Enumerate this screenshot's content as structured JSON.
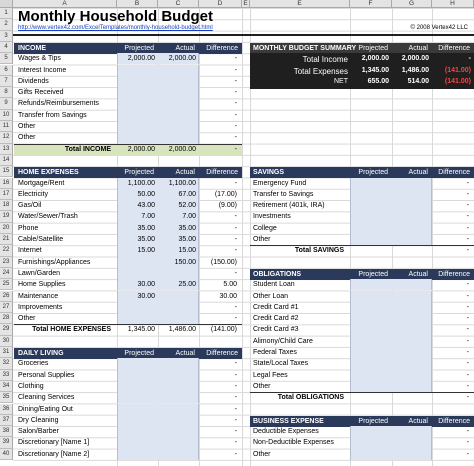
{
  "columns": [
    "A",
    "B",
    "C",
    "D",
    "E",
    "F",
    "G",
    "H"
  ],
  "rows": [
    "1",
    "2",
    "3",
    "4",
    "5",
    "6",
    "7",
    "8",
    "9",
    "10",
    "11",
    "12",
    "13",
    "14",
    "15",
    "16",
    "17",
    "18",
    "19",
    "20",
    "21",
    "22",
    "23",
    "24",
    "25",
    "26",
    "27",
    "28",
    "29",
    "30",
    "31",
    "32",
    "33",
    "34",
    "35",
    "36",
    "37",
    "38",
    "39",
    "40"
  ],
  "title": "Monthly Household Budget",
  "link": "http://www.vertex42.com/ExcelTemplates/monthly-household-budget.html",
  "copyright": "© 2008 Vertex42 LLC",
  "col_heads": {
    "projected": "Projected",
    "actual": "Actual",
    "difference": "Difference"
  },
  "income": {
    "header": "INCOME",
    "items": [
      {
        "label": "Wages & Tips",
        "projected": "2,000.00",
        "actual": "2,000.00",
        "diff": "-"
      },
      {
        "label": "Interest Income",
        "projected": "",
        "actual": "",
        "diff": "-"
      },
      {
        "label": "Dividends",
        "projected": "",
        "actual": "",
        "diff": "-"
      },
      {
        "label": "Gifts Received",
        "projected": "",
        "actual": "",
        "diff": "-"
      },
      {
        "label": "Refunds/Reimbursements",
        "projected": "",
        "actual": "",
        "diff": "-"
      },
      {
        "label": "Transfer from Savings",
        "projected": "",
        "actual": "",
        "diff": "-"
      },
      {
        "label": "Other",
        "projected": "",
        "actual": "",
        "diff": "-"
      },
      {
        "label": "Other",
        "projected": "",
        "actual": "",
        "diff": "-"
      }
    ],
    "total_label": "Total INCOME",
    "total_projected": "2,000.00",
    "total_actual": "2,000.00",
    "total_diff": "-"
  },
  "summary": {
    "header": "MONTHLY BUDGET SUMMARY",
    "rows": [
      {
        "label": "Total Income",
        "projected": "2,000.00",
        "actual": "2,000.00",
        "diff": "-"
      },
      {
        "label": "Total Expenses",
        "projected": "1,345.00",
        "actual": "1,486.00",
        "diff": "(141.00)"
      },
      {
        "label": "NET",
        "projected": "655.00",
        "actual": "514.00",
        "diff": "(141.00)"
      }
    ]
  },
  "home": {
    "header": "HOME EXPENSES",
    "items": [
      {
        "label": "Mortgage/Rent",
        "projected": "1,100.00",
        "actual": "1,100.00",
        "diff": "-"
      },
      {
        "label": "Electricity",
        "projected": "50.00",
        "actual": "67.00",
        "diff": "(17.00)"
      },
      {
        "label": "Gas/Oil",
        "projected": "43.00",
        "actual": "52.00",
        "diff": "(9.00)"
      },
      {
        "label": "Water/Sewer/Trash",
        "projected": "7.00",
        "actual": "7.00",
        "diff": "-"
      },
      {
        "label": "Phone",
        "projected": "35.00",
        "actual": "35.00",
        "diff": "-"
      },
      {
        "label": "Cable/Satellite",
        "projected": "35.00",
        "actual": "35.00",
        "diff": "-"
      },
      {
        "label": "Internet",
        "projected": "15.00",
        "actual": "15.00",
        "diff": "-"
      },
      {
        "label": "Furnishings/Appliances",
        "projected": "",
        "actual": "150.00",
        "diff": "(150.00)"
      },
      {
        "label": "Lawn/Garden",
        "projected": "",
        "actual": "",
        "diff": "-"
      },
      {
        "label": "Home Supplies",
        "projected": "30.00",
        "actual": "25.00",
        "diff": "5.00"
      },
      {
        "label": "Maintenance",
        "projected": "30.00",
        "actual": "",
        "diff": "30.00"
      },
      {
        "label": "Improvements",
        "projected": "",
        "actual": "",
        "diff": "-"
      },
      {
        "label": "Other",
        "projected": "",
        "actual": "",
        "diff": "-"
      }
    ],
    "total_label": "Total HOME EXPENSES",
    "total_projected": "1,345.00",
    "total_actual": "1,486.00",
    "total_diff": "(141.00)"
  },
  "daily": {
    "header": "DAILY LIVING",
    "items": [
      {
        "label": "Groceries"
      },
      {
        "label": "Personal Supplies"
      },
      {
        "label": "Clothing"
      },
      {
        "label": "Cleaning Services"
      },
      {
        "label": "Dining/Eating Out"
      },
      {
        "label": "Dry Cleaning"
      },
      {
        "label": "Salon/Barber"
      },
      {
        "label": "Discretionary [Name 1]"
      },
      {
        "label": "Discretionary [Name 2]"
      }
    ]
  },
  "savings": {
    "header": "SAVINGS",
    "items": [
      {
        "label": "Emergency Fund"
      },
      {
        "label": "Transfer to Savings"
      },
      {
        "label": "Retirement (401k, IRA)"
      },
      {
        "label": "Investments"
      },
      {
        "label": "College"
      },
      {
        "label": "Other"
      }
    ],
    "total_label": "Total SAVINGS",
    "total_diff": "-"
  },
  "obligations": {
    "header": "OBLIGATIONS",
    "items": [
      {
        "label": "Student Loan"
      },
      {
        "label": "Other Loan"
      },
      {
        "label": "Credit Card #1"
      },
      {
        "label": "Credit Card #2"
      },
      {
        "label": "Credit Card #3"
      },
      {
        "label": "Alimony/Child Care"
      },
      {
        "label": "Federal Taxes"
      },
      {
        "label": "State/Local Taxes"
      },
      {
        "label": "Legal Fees"
      },
      {
        "label": "Other"
      }
    ],
    "total_label": "Total OBLIGATIONS",
    "total_diff": "-"
  },
  "business": {
    "header": "BUSINESS EXPENSE",
    "items": [
      {
        "label": "Deductible Expenses"
      },
      {
        "label": "Non-Deductible Expenses"
      },
      {
        "label": "Other"
      }
    ]
  },
  "dash": "-"
}
